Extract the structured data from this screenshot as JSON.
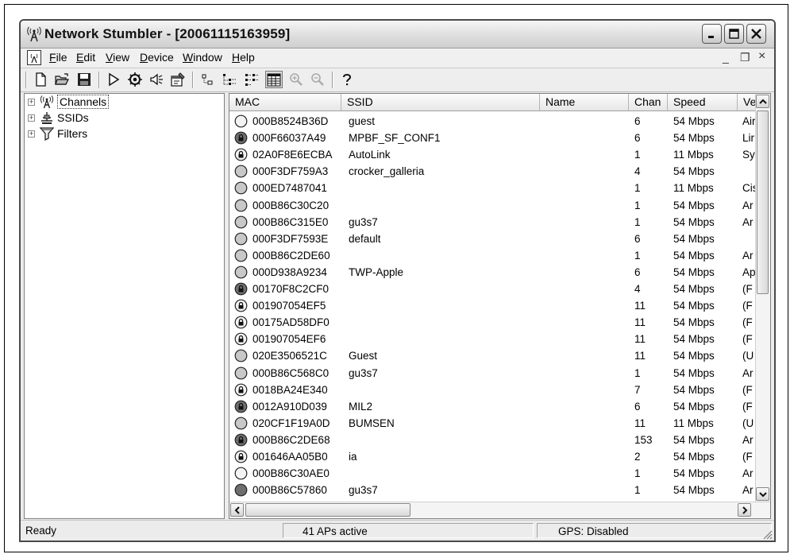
{
  "window": {
    "title": "Network Stumbler - [20061115163959]"
  },
  "menu": [
    "File",
    "Edit",
    "View",
    "Device",
    "Window",
    "Help"
  ],
  "mdi_controls": [
    "_",
    "❐",
    "×"
  ],
  "toolbar_icons": [
    "new-file-icon",
    "open-folder-icon",
    "save-icon",
    "play-icon",
    "auto-config-icon",
    "speaker-icon",
    "properties-icon",
    "tree-small-icon",
    "tree-list-icon",
    "list-view-icon",
    "details-view-icon",
    "zoom-in-icon",
    "zoom-out-icon",
    "help-icon"
  ],
  "tree": [
    {
      "label": "Channels",
      "icon": "antenna-icon",
      "selected": true
    },
    {
      "label": "SSIDs",
      "icon": "network-icon",
      "selected": false
    },
    {
      "label": "Filters",
      "icon": "filter-icon",
      "selected": false
    }
  ],
  "columns": [
    "MAC",
    "SSID",
    "Name",
    "Chan",
    "Speed",
    "Ve"
  ],
  "rows": [
    {
      "mac": "000B8524B36D",
      "ssid": "guest",
      "name": "",
      "chan": "6",
      "speed": "54 Mbps",
      "vendor": "Air",
      "icon": "open-light"
    },
    {
      "mac": "000F66037A49",
      "ssid": "MPBF_SF_CONF1",
      "name": "",
      "chan": "6",
      "speed": "54 Mbps",
      "vendor": "Lir",
      "icon": "locked-dark"
    },
    {
      "mac": "02A0F8E6ECBA",
      "ssid": "AutoLink",
      "name": "",
      "chan": "1",
      "speed": "11 Mbps",
      "vendor": "Sy",
      "icon": "locked-light"
    },
    {
      "mac": "000F3DF759A3",
      "ssid": "crocker_galleria",
      "name": "",
      "chan": "4",
      "speed": "54 Mbps",
      "vendor": "",
      "icon": "open-gray"
    },
    {
      "mac": "000ED7487041",
      "ssid": "",
      "name": "",
      "chan": "1",
      "speed": "11 Mbps",
      "vendor": "Cis",
      "icon": "open-gray"
    },
    {
      "mac": "000B86C30C20",
      "ssid": "",
      "name": "",
      "chan": "1",
      "speed": "54 Mbps",
      "vendor": "Ar",
      "icon": "open-gray"
    },
    {
      "mac": "000B86C315E0",
      "ssid": "gu3s7",
      "name": "",
      "chan": "1",
      "speed": "54 Mbps",
      "vendor": "Ar",
      "icon": "open-gray"
    },
    {
      "mac": "000F3DF7593E",
      "ssid": "default",
      "name": "",
      "chan": "6",
      "speed": "54 Mbps",
      "vendor": "",
      "icon": "open-gray"
    },
    {
      "mac": "000B86C2DE60",
      "ssid": "",
      "name": "",
      "chan": "1",
      "speed": "54 Mbps",
      "vendor": "Ar",
      "icon": "open-gray"
    },
    {
      "mac": "000D938A9234",
      "ssid": "TWP-Apple",
      "name": "",
      "chan": "6",
      "speed": "54 Mbps",
      "vendor": "Ap",
      "icon": "open-gray"
    },
    {
      "mac": "00170F8C2CF0",
      "ssid": "",
      "name": "",
      "chan": "4",
      "speed": "54 Mbps",
      "vendor": "(F",
      "icon": "locked-dark"
    },
    {
      "mac": "001907054EF5",
      "ssid": "",
      "name": "",
      "chan": "11",
      "speed": "54 Mbps",
      "vendor": "(F",
      "icon": "locked-light"
    },
    {
      "mac": "00175AD58DF0",
      "ssid": "",
      "name": "",
      "chan": "11",
      "speed": "54 Mbps",
      "vendor": "(F",
      "icon": "locked-light"
    },
    {
      "mac": "001907054EF6",
      "ssid": "",
      "name": "",
      "chan": "11",
      "speed": "54 Mbps",
      "vendor": "(F",
      "icon": "locked-light"
    },
    {
      "mac": "020E3506521C",
      "ssid": "Guest",
      "name": "",
      "chan": "11",
      "speed": "54 Mbps",
      "vendor": "(U",
      "icon": "open-gray"
    },
    {
      "mac": "000B86C568C0",
      "ssid": "gu3s7",
      "name": "",
      "chan": "1",
      "speed": "54 Mbps",
      "vendor": "Ar",
      "icon": "open-gray"
    },
    {
      "mac": "0018BA24E340",
      "ssid": "",
      "name": "",
      "chan": "7",
      "speed": "54 Mbps",
      "vendor": "(F",
      "icon": "locked-light"
    },
    {
      "mac": "0012A910D039",
      "ssid": "MIL2",
      "name": "",
      "chan": "6",
      "speed": "54 Mbps",
      "vendor": "(F",
      "icon": "locked-dark"
    },
    {
      "mac": "020CF1F19A0D",
      "ssid": "BUMSEN",
      "name": "",
      "chan": "11",
      "speed": "11 Mbps",
      "vendor": "(U",
      "icon": "open-gray"
    },
    {
      "mac": "000B86C2DE68",
      "ssid": "",
      "name": "",
      "chan": "153",
      "speed": "54 Mbps",
      "vendor": "Ar",
      "icon": "locked-dark"
    },
    {
      "mac": "001646AA05B0",
      "ssid": "ia",
      "name": "",
      "chan": "2",
      "speed": "54 Mbps",
      "vendor": "(F",
      "icon": "locked-light"
    },
    {
      "mac": "000B86C30AE0",
      "ssid": "",
      "name": "",
      "chan": "1",
      "speed": "54 Mbps",
      "vendor": "Ar",
      "icon": "open-light"
    },
    {
      "mac": "000B86C57860",
      "ssid": "gu3s7",
      "name": "",
      "chan": "1",
      "speed": "54 Mbps",
      "vendor": "Ar",
      "icon": "open-dark"
    }
  ],
  "status": {
    "left": "Ready",
    "middle": "41 APs active",
    "right": "GPS: Disabled"
  }
}
